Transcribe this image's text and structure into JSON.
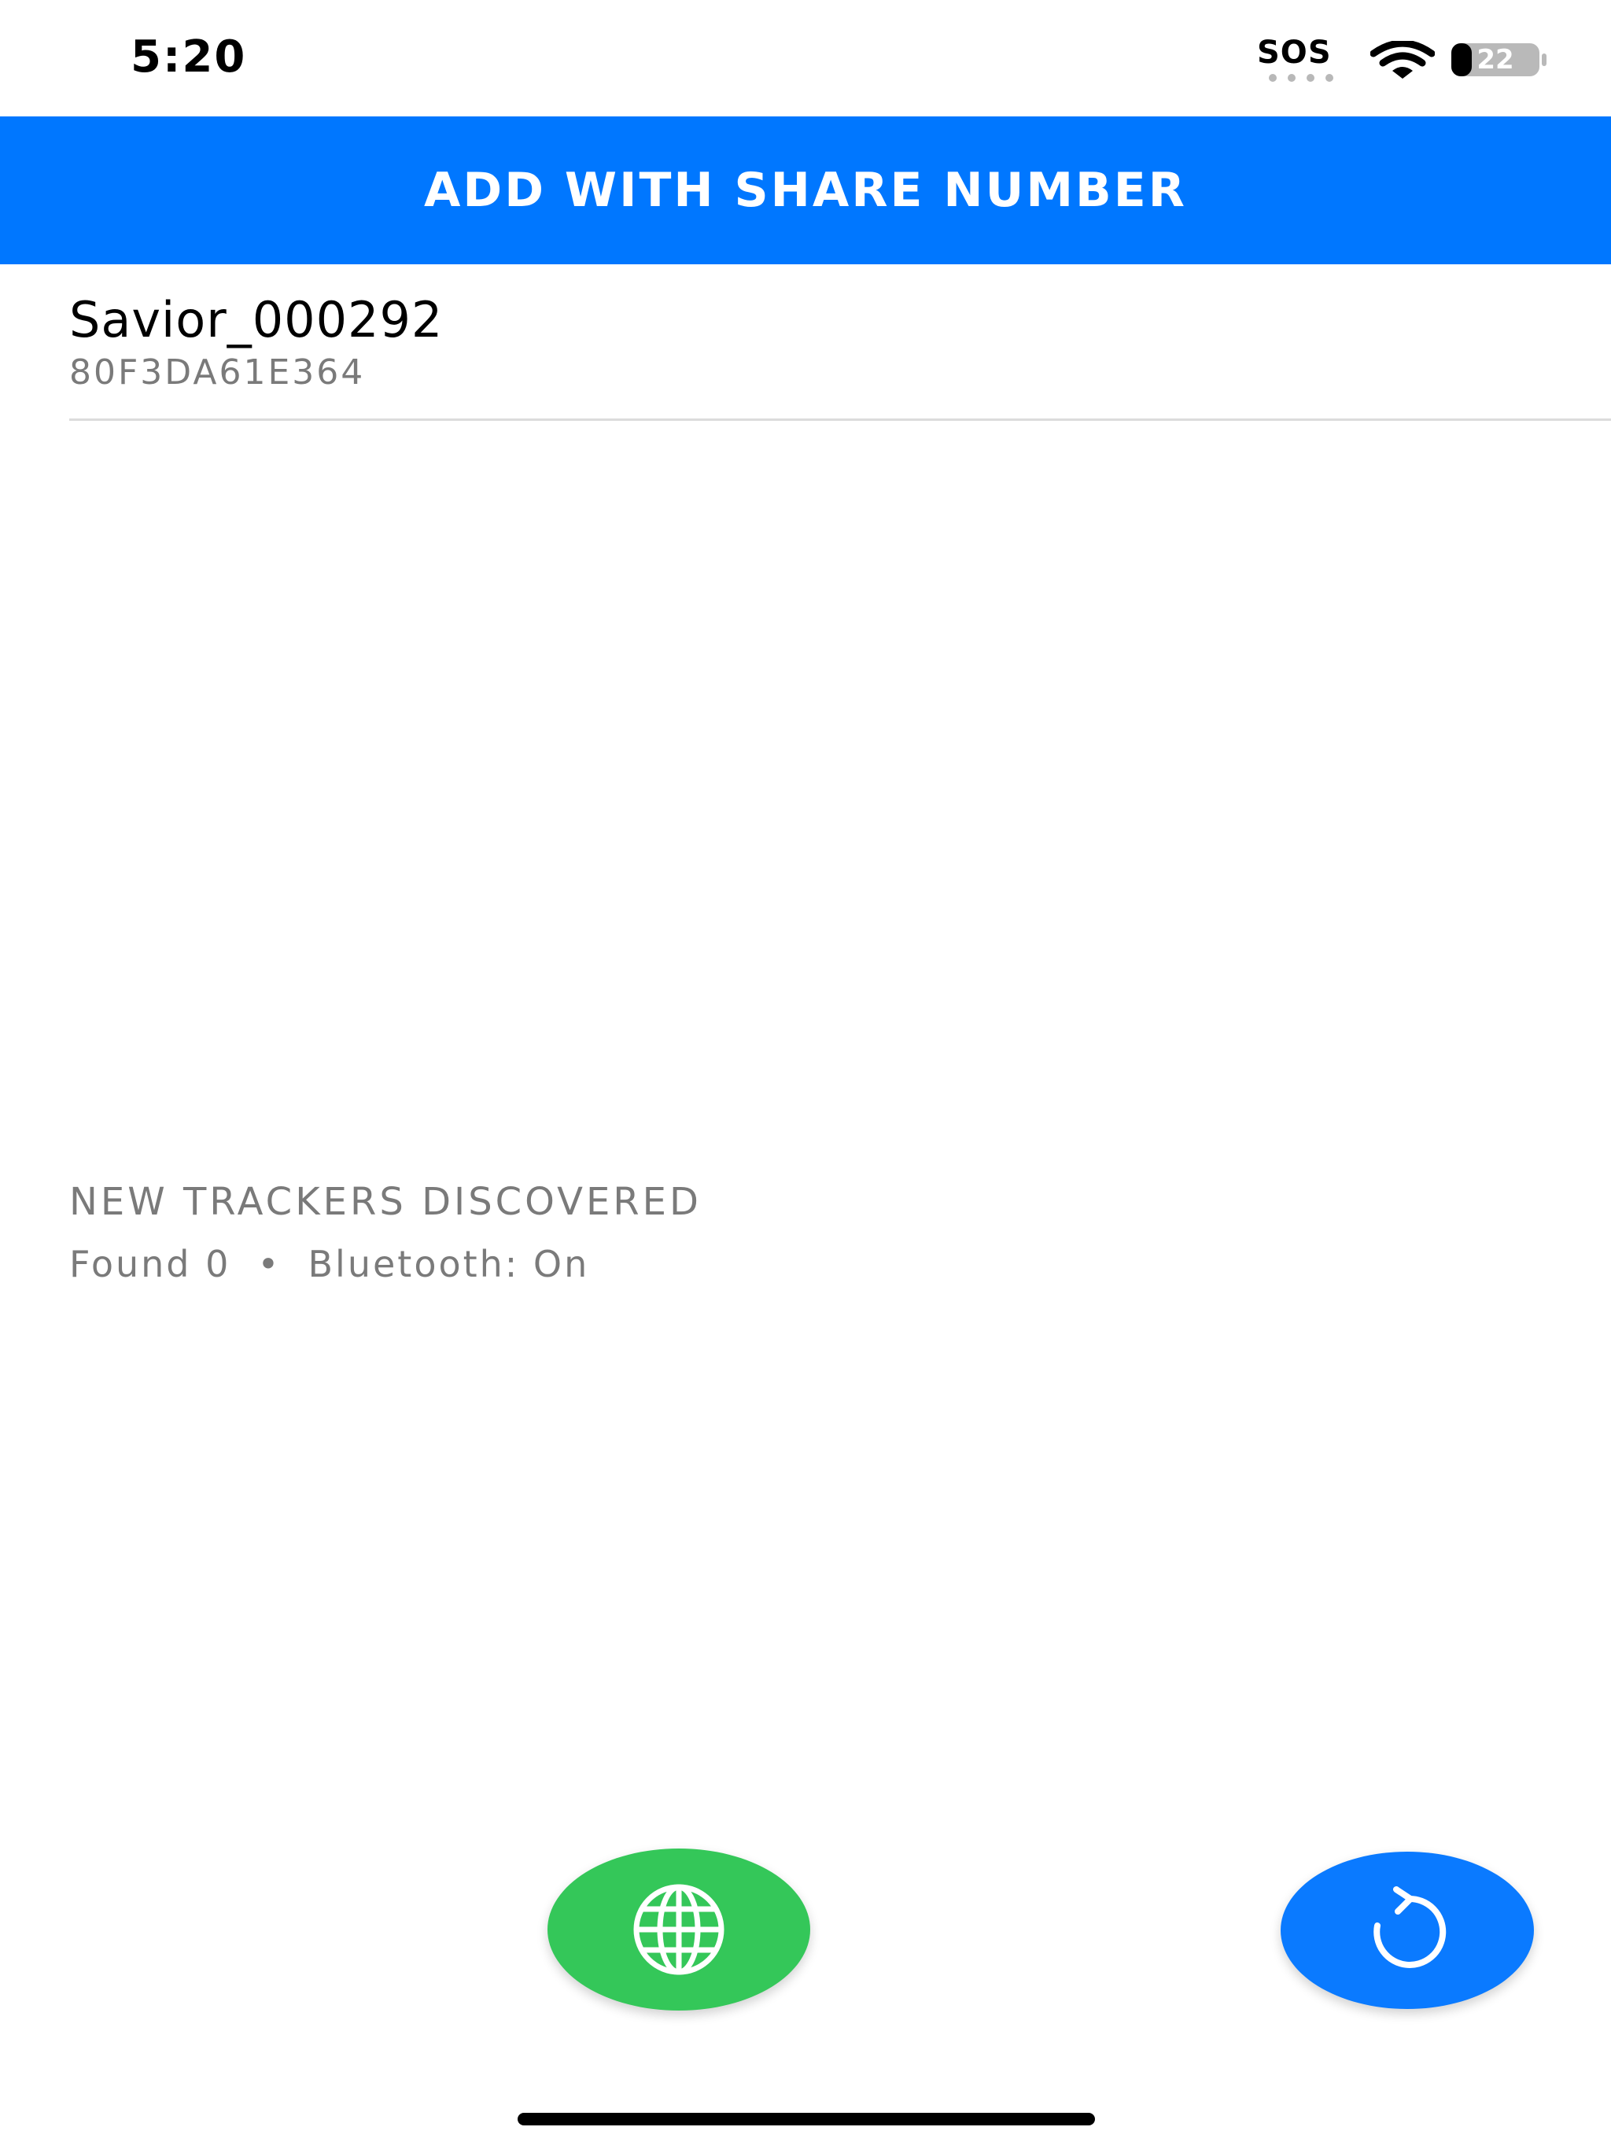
{
  "status_bar": {
    "time": "5:20",
    "sos": "SOS",
    "battery_level": "22",
    "wifi_icon": "wifi-icon",
    "battery_icon": "battery-icon"
  },
  "header": {
    "title": "ADD WITH SHARE NUMBER",
    "background_color": "#0077ff"
  },
  "trackers": [
    {
      "name": "Savior_000292",
      "id": "80F3DA61E364"
    }
  ],
  "discovery": {
    "heading": "NEW TRACKERS DISCOVERED",
    "found": "Found 0",
    "separator": "•",
    "bluetooth": "Bluetooth: On"
  },
  "actions": {
    "globe_button_icon": "globe-icon",
    "globe_button_color": "#34c759",
    "refresh_button_icon": "refresh-icon",
    "refresh_button_color": "#0a7aff"
  }
}
